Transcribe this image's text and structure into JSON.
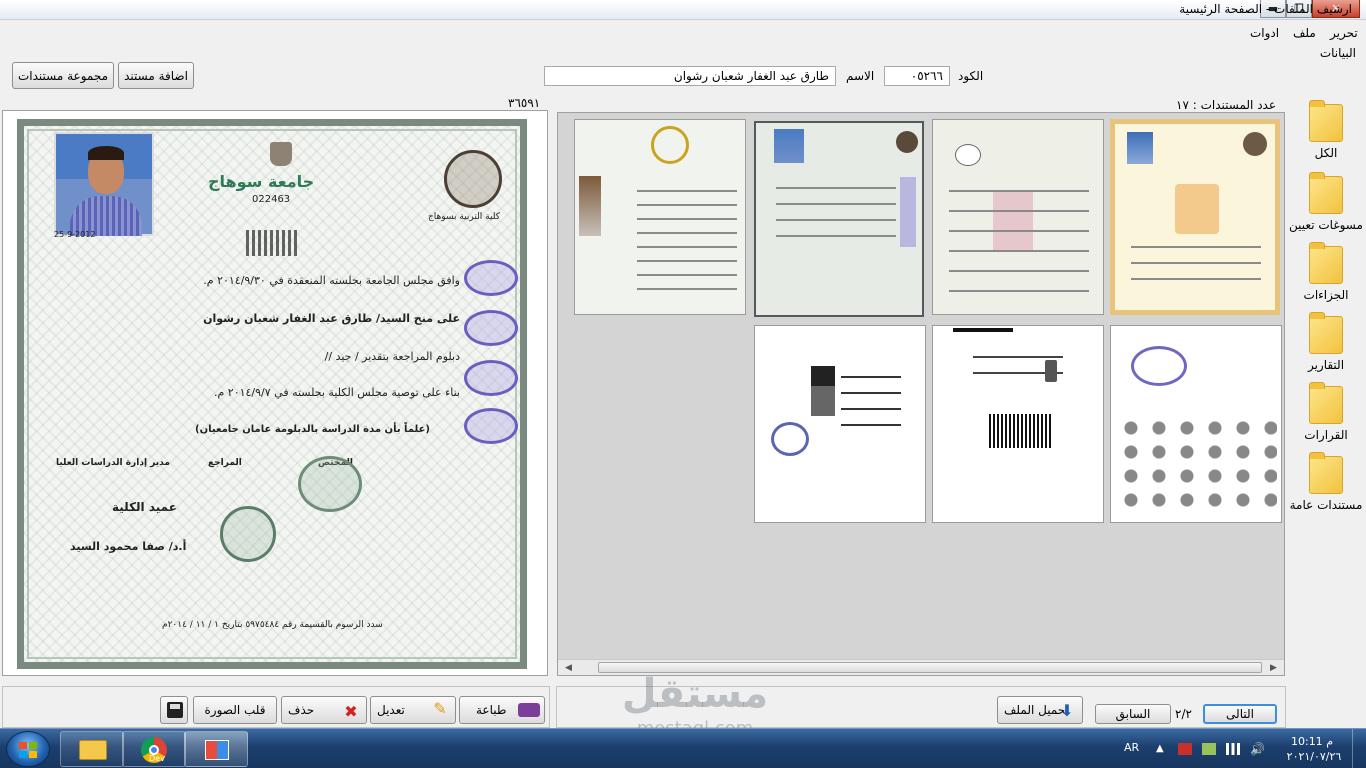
{
  "window": {
    "title": "ارشيف الملفات - الصفحة الرئيسية",
    "minimize_glyph": "▬",
    "maximize_glyph": "❐",
    "close_glyph": "✕"
  },
  "menu": {
    "edit": "تحرير",
    "file": "ملف",
    "tools": "ادوات"
  },
  "section_label": "البيانات",
  "toolbar": {
    "add_document": "اضافة مستند",
    "document_group": "مجموعة مستندات"
  },
  "form": {
    "code_label": "الكود",
    "code_value": "٠٥٢٦٦",
    "name_label": "الاسم",
    "name_value": "طارق عبد الغفار شعبان رشوان"
  },
  "preview": {
    "counter": "٣٦٥٩١",
    "certificate": {
      "university": "جامعة سوهاج",
      "serial": "022463",
      "photo_date": "25-9-2012",
      "faculty": "كلية التربية بسوهاج",
      "line1": "وافق مجلس الجامعة بجلسته المنعقدة في ٢٠١٤/٩/٣٠ م.",
      "line2": "على منح السيد/ طارق عبد الغفار شعبان رشوان",
      "line3": "دبلوم المراجعة بتقدير / جيد //",
      "line4": "بناء على توصية مجلس الكلية بجلسته في ٢٠١٤/٩/٧ م.",
      "line5": "(علماً بأن مدة الدراسة بالدبلومة عامان جامعيان)",
      "sig_director": "مدير إدارة الدراسات العليا",
      "sig_reviewer": "المراجع",
      "sig_checker": "المختص",
      "dean_title": "عميد الكلية",
      "dean_name": "أ.د/ صفا محمود السيد",
      "footer": "سدد الرسوم بالقسيمة رقم ٥٩٧٥٤٨٤ بتاريخ ١ / ١١ / ٢٠١٤م"
    }
  },
  "grid": {
    "count_label": "عدد المستندات : ١٧"
  },
  "sidebar": {
    "items": [
      {
        "label": "الكل",
        "icon": "folder-icon"
      },
      {
        "label": "مسوغات تعيين",
        "icon": "folder-icon"
      },
      {
        "label": "الجزاءات",
        "icon": "folder-icon"
      },
      {
        "label": "التقارير",
        "icon": "folder-icon"
      },
      {
        "label": "القرارات",
        "icon": "folder-icon"
      },
      {
        "label": "مستندات عامة",
        "icon": "folder-icon"
      }
    ]
  },
  "actions": {
    "print": "طباعة",
    "edit": "تعديل",
    "delete": "حذف",
    "flip": "قلب الصورة",
    "upload": "تحميل الملف",
    "previous": "السابق",
    "page": "٢/٢",
    "next": "التالى"
  },
  "taskbar": {
    "chrome_label": "Dev",
    "lang": "AR",
    "time": "10:11 م",
    "date": "٢٠٢١/٠٧/٢٦"
  },
  "watermark": {
    "arabic": "مستقل",
    "latin": "mostaql.com"
  },
  "colors": {
    "selection": "#1e6bc9",
    "folder": "#f2c23f",
    "taskbar": "#1c3f6e"
  }
}
